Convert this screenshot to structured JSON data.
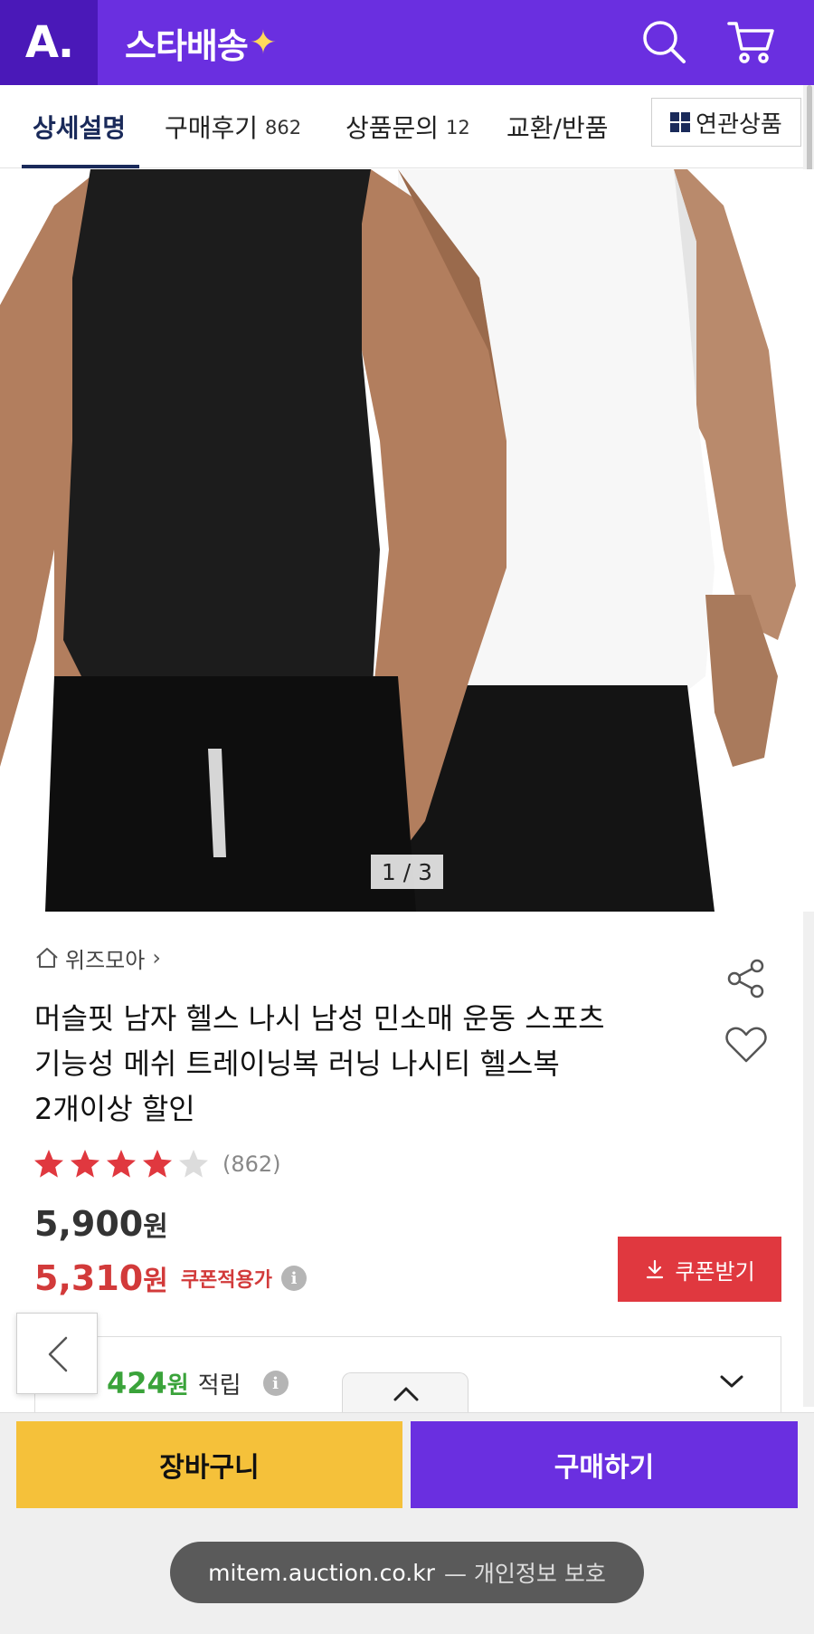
{
  "header": {
    "logo": "A.",
    "promo_title": "스타배송",
    "promo_spark": "✦",
    "search_icon": "search-icon",
    "cart_icon": "cart-icon",
    "colors": {
      "brand": "#6a2fe0",
      "brand_dark": "#4a18b8",
      "spark": "#ffd95a"
    }
  },
  "tabs": [
    {
      "label": "상세설명",
      "count": ""
    },
    {
      "label": "구매후기",
      "count": "862"
    },
    {
      "label": "상품문의",
      "count": "12"
    },
    {
      "label": "교환/반품",
      "count": ""
    }
  ],
  "related_button": "연관상품",
  "image": {
    "indicator": "1 / 3"
  },
  "product": {
    "seller": "위즈모아",
    "title_lines": [
      "머슬핏 남자 헬스 나시 남성 민소매 운동 스포츠",
      "기능성 메쉬 트레이닝복 러닝 나시티 헬스복",
      "2개이상 할인"
    ],
    "rating": 4.5,
    "review_count": "(862)",
    "original_price": "5,900",
    "price_unit": "원",
    "sale_price": "5,310",
    "coupon_note": "쿠폰적용가",
    "coupon_button": "쿠폰받기",
    "points_amount": "424",
    "points_unit": "원",
    "points_label": "적립"
  },
  "actions": {
    "cart": "장바구니",
    "buy": "구매하기"
  },
  "browser": {
    "domain": "mitem.auction.co.kr",
    "privacy": "— 개인정보 보호"
  }
}
